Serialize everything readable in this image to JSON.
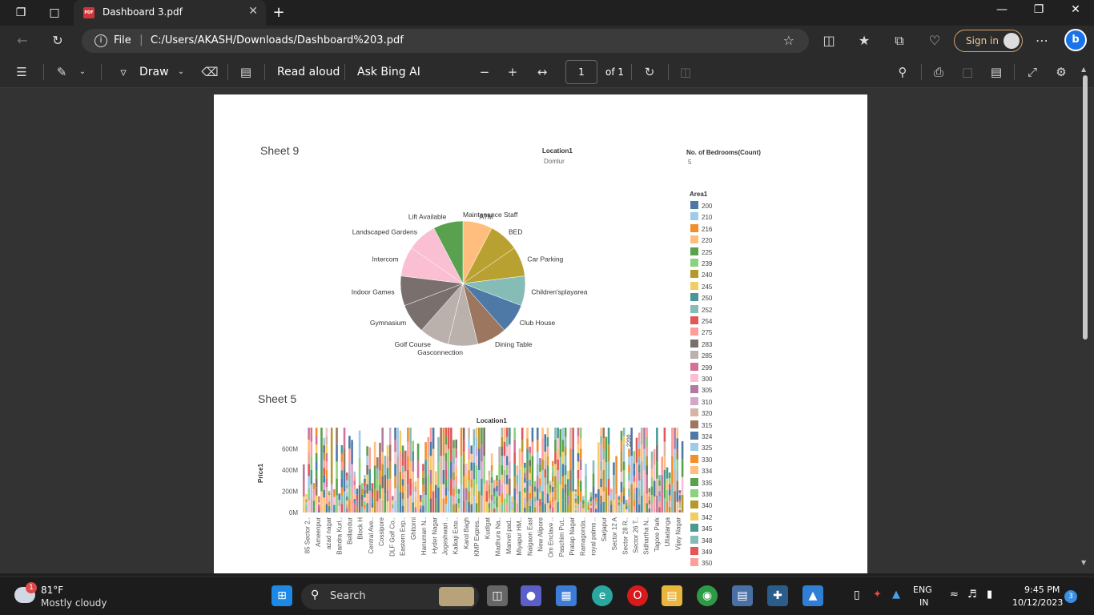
{
  "browser": {
    "tab_title": "Dashboard 3.pdf",
    "pdf_badge": "PDF",
    "new_tab": "+",
    "address_scheme": "File",
    "address_url": "C:/Users/AKASH/Downloads/Dashboard%203.pdf",
    "sign_in": "Sign in",
    "bing_label": "b"
  },
  "pdf_toolbar": {
    "draw_label": "Draw",
    "read_aloud_label": "Read aloud",
    "ask_bing_label": "Ask Bing AI",
    "page_current": "1",
    "page_total": "of 1"
  },
  "document": {
    "sheet9_title": "Sheet 9",
    "location_label": "Location1",
    "location_value": "Domlur",
    "bedrooms_label": "No. of Bedrooms(Count)",
    "bedrooms_value": "5",
    "area_legend_title": "Area1",
    "sheet5_title": "Sheet 5",
    "bar_chart_title": "Location1",
    "bar_ylabel": "Price1",
    "bar_annotation": "2200"
  },
  "chart_data": [
    {
      "type": "pie",
      "categories": [
        "Maintenance Staff",
        "ATM",
        "BED",
        "Car Parking",
        "Children'splayarea",
        "Club House",
        "Dining Table",
        "Gasconnection",
        "Golf Course",
        "Gymnasium",
        "Indoor Games",
        "Intercom",
        "Landscaped Gardens",
        "Lift Available"
      ],
      "values": [
        0,
        1,
        1,
        1,
        1,
        1,
        1,
        1,
        1,
        1,
        1,
        1,
        1,
        1
      ],
      "colors": [
        "#ffbe7d",
        "#ffbe7d",
        "#b9a131",
        "#b9a131",
        "#86bcb6",
        "#4e79a7",
        "#9d7660",
        "#bab0ac",
        "#bab0ac",
        "#79706e",
        "#79706e",
        "#fabfd2",
        "#fabfd2",
        "#59a14f"
      ]
    },
    {
      "type": "bar",
      "title": "Location1",
      "ylabel": "Price1",
      "yticks": [
        "0M",
        "200M",
        "400M",
        "600M"
      ],
      "ylim": [
        0,
        800
      ],
      "categories": [
        "85 Sector 2..",
        "Ameenpur",
        "azad nagar",
        "Bandra Kurl..",
        "Bellandur",
        "Block H",
        "Central Ave..",
        "Cossipore",
        "DLF Golf Co..",
        "Eastern Exp..",
        "Ghitorni",
        "Hanuman N..",
        "Hyder Nagar",
        "Jogeshwari ..",
        "Kalkaji Exte..",
        "Karol Bagh",
        "KMP Expres..",
        "Kudlgat",
        "Madhura Na..",
        "Manvel pad..",
        "Miyapur HM..",
        "Naigaon East",
        "New Alipore",
        "Om Enclave ..",
        "Paschim Put..",
        "Pratap Nagar",
        "Ramagonda..",
        "royal palms ..",
        "Sarjapur",
        "Sector 12 A",
        "Sector 28 R..",
        "Sector 26 T..",
        "Sidhartha N..",
        "Tagore Park",
        "Ultadanga",
        "Vijay Nagar"
      ]
    }
  ],
  "area_legend": [
    {
      "label": "200",
      "color": "#4e79a7"
    },
    {
      "label": "210",
      "color": "#a0cbe8"
    },
    {
      "label": "216",
      "color": "#f28e2b"
    },
    {
      "label": "220",
      "color": "#ffbe7d"
    },
    {
      "label": "225",
      "color": "#59a14f"
    },
    {
      "label": "239",
      "color": "#8cd17d"
    },
    {
      "label": "240",
      "color": "#b6992d"
    },
    {
      "label": "245",
      "color": "#f1ce63"
    },
    {
      "label": "250",
      "color": "#499894"
    },
    {
      "label": "252",
      "color": "#86bcb6"
    },
    {
      "label": "254",
      "color": "#e15759"
    },
    {
      "label": "275",
      "color": "#ff9d9a"
    },
    {
      "label": "283",
      "color": "#79706e"
    },
    {
      "label": "285",
      "color": "#bab0ac"
    },
    {
      "label": "299",
      "color": "#d37295"
    },
    {
      "label": "300",
      "color": "#fabfd2"
    },
    {
      "label": "305",
      "color": "#b07aa1"
    },
    {
      "label": "310",
      "color": "#d4a6c8"
    },
    {
      "label": "320",
      "color": "#d7b5a6"
    },
    {
      "label": "315",
      "color": "#9d7660"
    },
    {
      "label": "324",
      "color": "#4e79a7"
    },
    {
      "label": "325",
      "color": "#a0cbe8"
    },
    {
      "label": "330",
      "color": "#f28e2b"
    },
    {
      "label": "334",
      "color": "#ffbe7d"
    },
    {
      "label": "335",
      "color": "#59a14f"
    },
    {
      "label": "338",
      "color": "#8cd17d"
    },
    {
      "label": "340",
      "color": "#b6992d"
    },
    {
      "label": "342",
      "color": "#f1ce63"
    },
    {
      "label": "345",
      "color": "#499894"
    },
    {
      "label": "348",
      "color": "#86bcb6"
    },
    {
      "label": "349",
      "color": "#e15759"
    },
    {
      "label": "350",
      "color": "#ff9d9a"
    }
  ],
  "taskbar": {
    "weather_temp": "81°F",
    "weather_desc": "Mostly cloudy",
    "weather_badge": "1",
    "search_label": "Search",
    "lang_top": "ENG",
    "lang_bottom": "IN",
    "time": "9:45 PM",
    "date": "10/12/2023",
    "notif_count": "3"
  }
}
